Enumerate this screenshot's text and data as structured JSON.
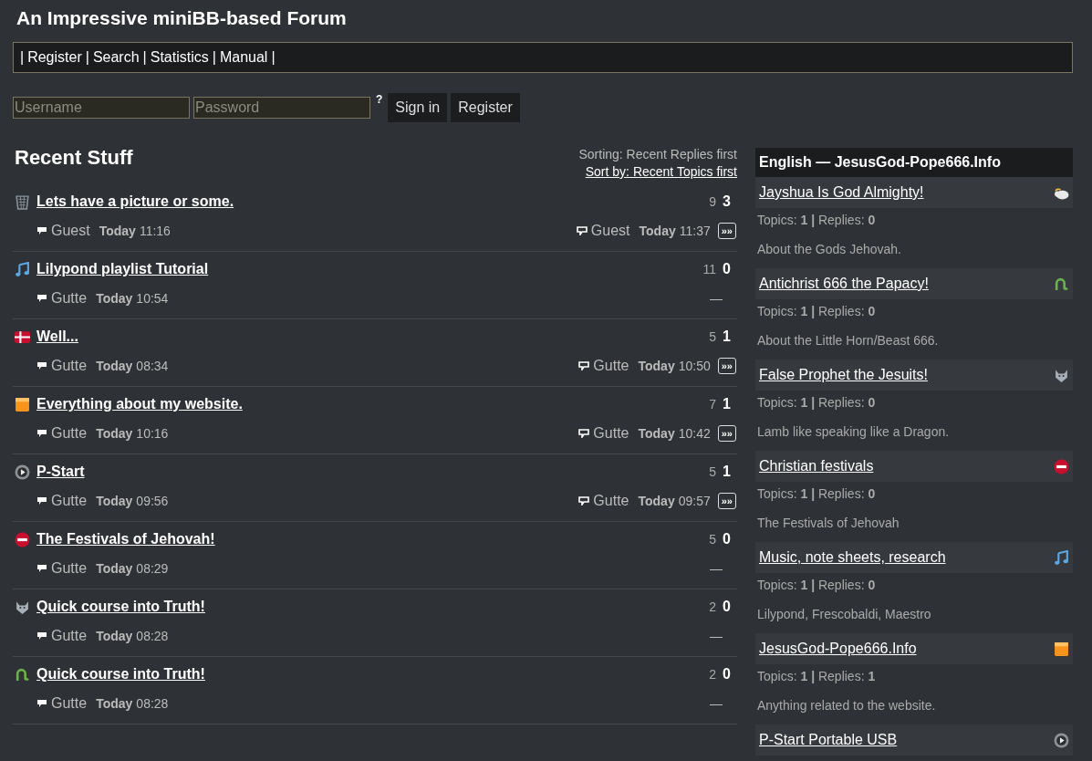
{
  "site_title": "An Impressive miniBB-based Forum",
  "menu": {
    "separator": "|",
    "links": [
      "Register",
      "Search",
      "Statistics",
      "Manual"
    ]
  },
  "login": {
    "username_placeholder": "Username",
    "password_placeholder": "Password",
    "help": "?",
    "buttons": [
      "Sign in",
      "Register"
    ]
  },
  "recent": {
    "heading": "Recent Stuff",
    "sorting": "Sorting: Recent Replies first",
    "sort_link": "Sort by: Recent Topics first",
    "topics": [
      {
        "kind": "basket",
        "title": "Lets have a picture or some.",
        "views": "9",
        "replies": "3",
        "author": "Guest",
        "day": "Today",
        "time": "11:16",
        "last": {
          "author": "Guest",
          "day": "Today",
          "time": "11:37",
          "go": "»»"
        }
      },
      {
        "kind": "note",
        "title": "Lilypond playlist Tutorial",
        "views": "11",
        "replies": "0",
        "author": "Gutte",
        "day": "Today",
        "time": "10:54",
        "no_reply": "—"
      },
      {
        "kind": "flag",
        "title": "Well...",
        "views": "5",
        "replies": "1",
        "author": "Gutte",
        "day": "Today",
        "time": "08:34",
        "last": {
          "author": "Gutte",
          "day": "Today",
          "time": "10:50",
          "go": "»»"
        }
      },
      {
        "kind": "tile",
        "title": "Everything about my website.",
        "views": "7",
        "replies": "1",
        "author": "Gutte",
        "day": "Today",
        "time": "10:16",
        "last": {
          "author": "Gutte",
          "day": "Today",
          "time": "10:42",
          "go": "»»"
        }
      },
      {
        "kind": "play",
        "title": "P-Start",
        "views": "5",
        "replies": "1",
        "author": "Gutte",
        "day": "Today",
        "time": "09:56",
        "last": {
          "author": "Gutte",
          "day": "Today",
          "time": "09:57",
          "go": "»»"
        }
      },
      {
        "kind": "noentry",
        "title": "The Festivals of Jehovah!",
        "views": "5",
        "replies": "0",
        "author": "Gutte",
        "day": "Today",
        "time": "08:29",
        "no_reply": "—"
      },
      {
        "kind": "wolf",
        "title": "Quick course into Truth!",
        "views": "2",
        "replies": "0",
        "author": "Gutte",
        "day": "Today",
        "time": "08:28",
        "no_reply": "—"
      },
      {
        "kind": "snake",
        "title": "Quick course into Truth!",
        "views": "2",
        "replies": "0",
        "author": "Gutte",
        "day": "Today",
        "time": "08:28",
        "no_reply": "—"
      }
    ]
  },
  "forums": {
    "heading": "English — JesusGod-Pope666.Info",
    "items": [
      {
        "kind": "sheep",
        "title": "Jayshua Is God Almighty!",
        "stats": "Topics: **1 |** Replies: **0**",
        "description": "About the Gods Jehovah."
      },
      {
        "kind": "snake",
        "title": "Antichrist 666 the Papacy!",
        "stats": "Topics: **1 |** Replies: **0**",
        "description": "About the Little Horn/Beast 666."
      },
      {
        "kind": "wolf",
        "title": "False Prophet the Jesuits!",
        "stats": "Topics: **1 |** Replies: **0**",
        "description": "Lamb like speaking like a Dragon."
      },
      {
        "kind": "noentry",
        "title": "Christian festivals",
        "stats": "Topics: **1 |** Replies: **0**",
        "description": "The Festivals of Jehovah"
      },
      {
        "kind": "note",
        "title": "Music, note sheets, research",
        "stats": "Topics: **1 |** Replies: **0**",
        "description": "Lilypond, Frescobaldi, Maestro"
      },
      {
        "kind": "tile",
        "title": "JesusGod-Pope666.Info",
        "stats": "Topics: **1 |** Replies: **1**",
        "description": "Anything related to the website."
      },
      {
        "kind": "play",
        "title": "P-Start Portable USB"
      }
    ]
  }
}
